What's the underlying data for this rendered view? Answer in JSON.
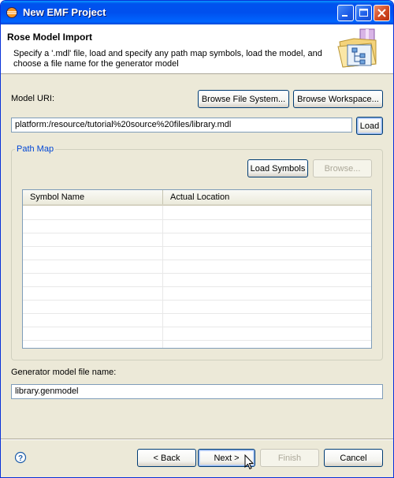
{
  "window": {
    "title": "New EMF Project"
  },
  "header": {
    "title": "Rose Model Import",
    "description": "Specify a '.mdl' file, load and specify any path map symbols, load the model, and choose a file name for the generator model"
  },
  "model_uri": {
    "label": "Model URI:",
    "browse_fs": "Browse File System...",
    "browse_ws": "Browse Workspace...",
    "value": "platform:/resource/tutorial%20source%20files/library.mdl",
    "load": "Load"
  },
  "path_map": {
    "title": "Path Map",
    "load_symbols": "Load Symbols",
    "browse": "Browse...",
    "columns": [
      "Symbol Name",
      "Actual Location"
    ],
    "rows": []
  },
  "generator": {
    "label": "Generator model file name:",
    "value": "library.genmodel"
  },
  "footer": {
    "back": "< Back",
    "next": "Next >",
    "finish": "Finish",
    "cancel": "Cancel"
  },
  "colors": {
    "titlebar": "#0053ee",
    "dialog": "#ece9d8",
    "group_title": "#0046d5"
  },
  "icons": [
    "eclipse-app-icon",
    "minimize-icon",
    "maximize-icon",
    "close-icon",
    "wizard-banner-icon",
    "help-icon",
    "mouse-cursor-icon"
  ]
}
